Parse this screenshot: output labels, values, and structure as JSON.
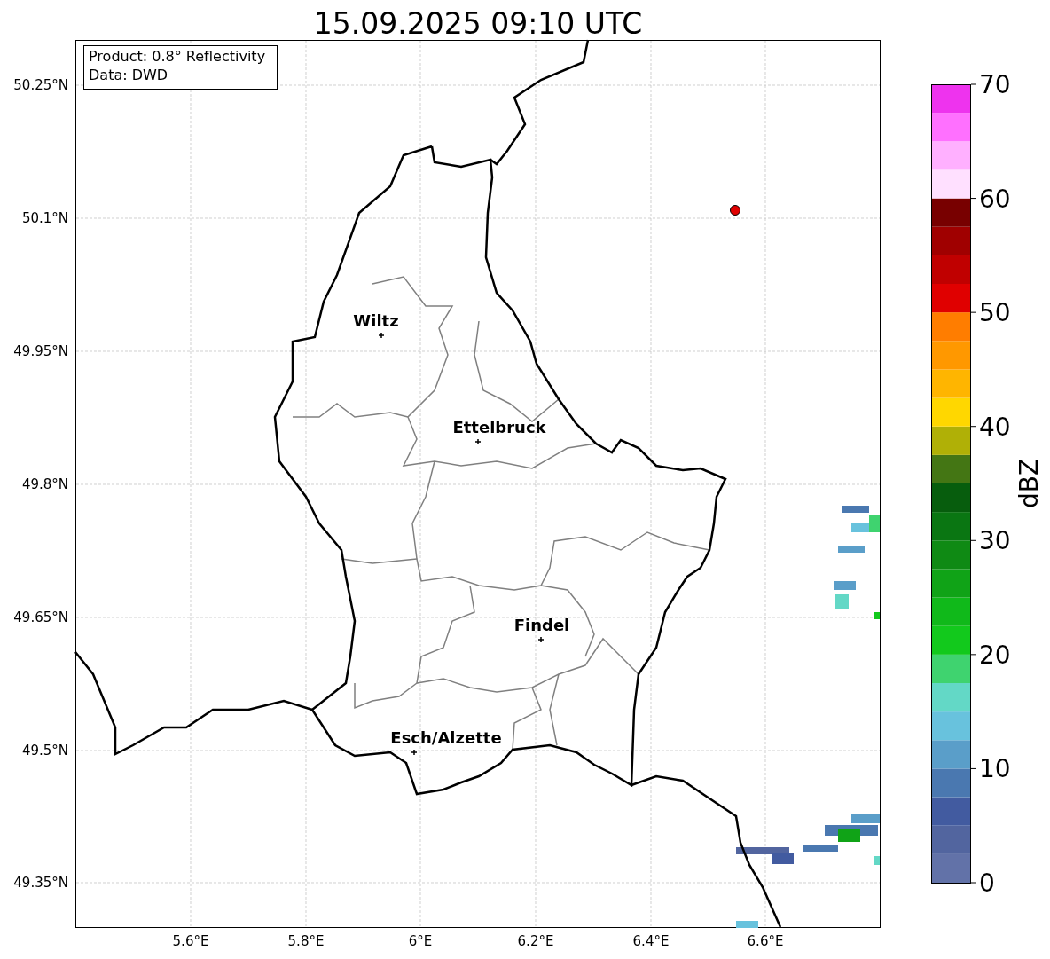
{
  "title": "15.09.2025 09:10 UTC",
  "info_box": {
    "lines": [
      "Product: 0.8° Reflectivity",
      "Data: DWD"
    ]
  },
  "y_ticks": [
    "50.25°N",
    "50.1°N",
    "49.95°N",
    "49.8°N",
    "49.65°N",
    "49.5°N",
    "49.35°N"
  ],
  "x_ticks": [
    "5.6°E",
    "5.8°E",
    "6°E",
    "6.2°E",
    "6.4°E",
    "6.6°E"
  ],
  "cities": [
    {
      "name": "Wiltz"
    },
    {
      "name": "Ettelbruck"
    },
    {
      "name": "Findel"
    },
    {
      "name": "Esch/Alzette"
    }
  ],
  "colorbar": {
    "label": "dBZ",
    "ticks": [
      "70",
      "60",
      "50",
      "40",
      "30",
      "20",
      "10",
      "0"
    ]
  }
}
